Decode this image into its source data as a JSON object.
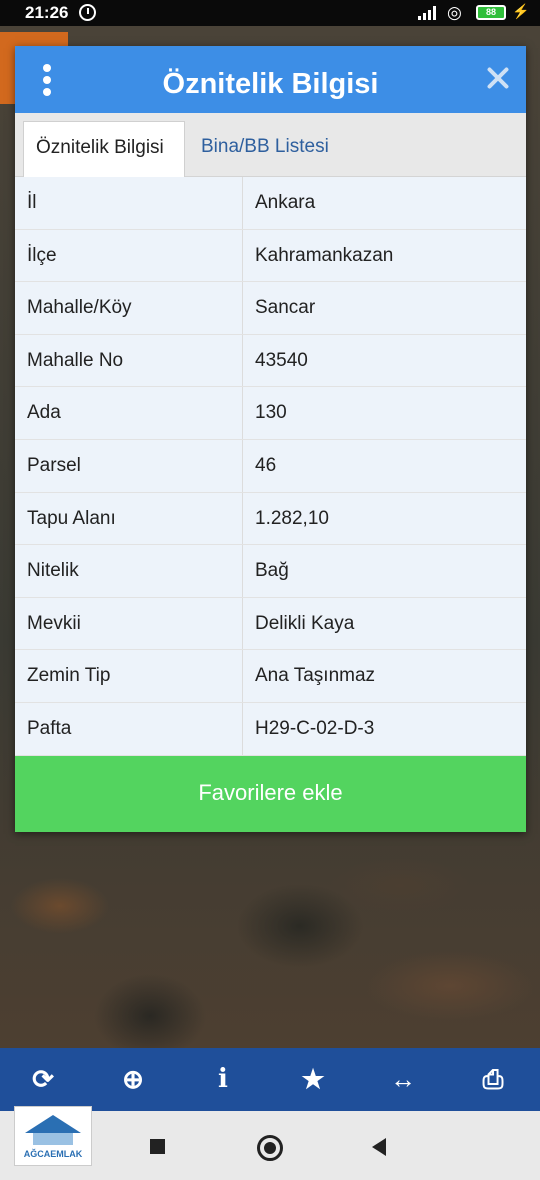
{
  "status_bar": {
    "time": "21:26",
    "battery": "88"
  },
  "dialog": {
    "title": "Öznitelik Bilgisi",
    "tabs": [
      {
        "label": "Öznitelik Bilgisi",
        "active": true
      },
      {
        "label": "Bina/BB Listesi",
        "active": false
      }
    ],
    "rows": [
      {
        "key": "İl",
        "value": "Ankara"
      },
      {
        "key": "İlçe",
        "value": "Kahramankazan"
      },
      {
        "key": "Mahalle/Köy",
        "value": "Sancar"
      },
      {
        "key": "Mahalle No",
        "value": "43540"
      },
      {
        "key": "Ada",
        "value": "130"
      },
      {
        "key": "Parsel",
        "value": "46"
      },
      {
        "key": "Tapu Alanı",
        "value": "1.282,10"
      },
      {
        "key": "Nitelik",
        "value": "Bağ"
      },
      {
        "key": "Mevkii",
        "value": "Delikli Kaya"
      },
      {
        "key": "Zemin Tip",
        "value": "Ana Taşınmaz"
      },
      {
        "key": "Pafta",
        "value": "H29-C-02-D-3"
      }
    ],
    "favorite_button": "Favorilere ekle"
  },
  "toolbar": {
    "icons": [
      "refresh-icon",
      "crosshair-icon",
      "info-icon",
      "star-icon",
      "resize-icon",
      "print-icon"
    ]
  },
  "logo": {
    "text": "AĞCAEMLAK"
  },
  "colors": {
    "header_blue": "#3d8ee6",
    "favorite_green": "#53d45f",
    "toolbar_blue": "#1f4f9a"
  }
}
